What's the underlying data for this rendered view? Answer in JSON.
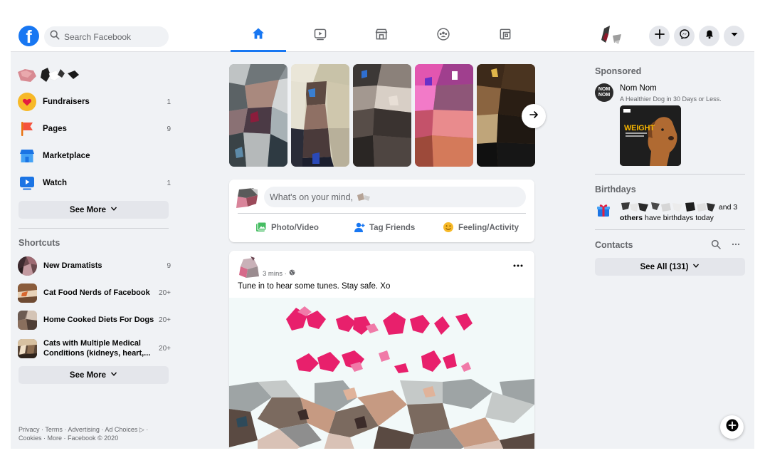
{
  "app": {
    "name": "Facebook",
    "logo_letter": "f"
  },
  "search": {
    "placeholder": "Search Facebook"
  },
  "nav_tabs": [
    {
      "name": "Home",
      "icon": "home-icon",
      "active": true
    },
    {
      "name": "Watch",
      "icon": "watch-icon",
      "active": false
    },
    {
      "name": "Marketplace",
      "icon": "marketplace-icon",
      "active": false
    },
    {
      "name": "Groups",
      "icon": "groups-icon",
      "active": false
    },
    {
      "name": "Gaming",
      "icon": "gaming-icon",
      "active": false
    }
  ],
  "top_right_buttons": [
    "plus-icon",
    "messenger-icon",
    "notifications-icon",
    "dropdown-caret-icon"
  ],
  "sidebar": {
    "items": [
      {
        "label": "Fundraisers",
        "count": "1",
        "icon": "fundraisers-icon"
      },
      {
        "label": "Pages",
        "count": "9",
        "icon": "pages-flag-icon"
      },
      {
        "label": "Marketplace",
        "count": "",
        "icon": "marketplace-shop-icon"
      },
      {
        "label": "Watch",
        "count": "1",
        "icon": "watch-play-icon"
      }
    ],
    "see_more_label": "See More",
    "shortcuts_title": "Shortcuts",
    "shortcuts": [
      {
        "label": "New Dramatists",
        "count": "9"
      },
      {
        "label": "Cat Food Nerds of Facebook",
        "count": "20+"
      },
      {
        "label": "Home Cooked Diets For Dogs",
        "count": "20+"
      },
      {
        "label": "Cats with Multiple Medical Conditions (kidneys, heart,...",
        "count": "20+"
      }
    ],
    "shortcuts_see_more_label": "See More",
    "footer_line1": "Privacy · Terms · Advertising · Ad Choices ▷ ·",
    "footer_line2": "Cookies · More · Facebook © 2020"
  },
  "composer": {
    "placeholder": "What's on your mind,",
    "actions": [
      {
        "label": "Photo/Video",
        "icon": "photo-video-icon",
        "color": "#45bd62"
      },
      {
        "label": "Tag Friends",
        "icon": "tag-friends-icon",
        "color": "#1877f2"
      },
      {
        "label": "Feeling/Activity",
        "icon": "feeling-icon",
        "color": "#f7b928"
      }
    ]
  },
  "post": {
    "time": "3 mins ·",
    "text": "Tune in to hear some tunes. Stay safe. Xo"
  },
  "right": {
    "sponsored_title": "Sponsored",
    "ad": {
      "logo_text": "NOM NOM",
      "name": "Nom Nom",
      "description": "A Healthier Dog in 30 Days or Less.",
      "image_headline": "WEIGHT"
    },
    "birthdays_title": "Birthdays",
    "birthdays_text_and": "and 3",
    "birthdays_others": "others",
    "birthdays_suffix": "have birthdays today",
    "contacts_title": "Contacts",
    "contacts_see_all": "See All (131)"
  },
  "colors": {
    "accent": "#1877f2",
    "background": "#f0f2f5",
    "secondary_text": "#65676b"
  }
}
